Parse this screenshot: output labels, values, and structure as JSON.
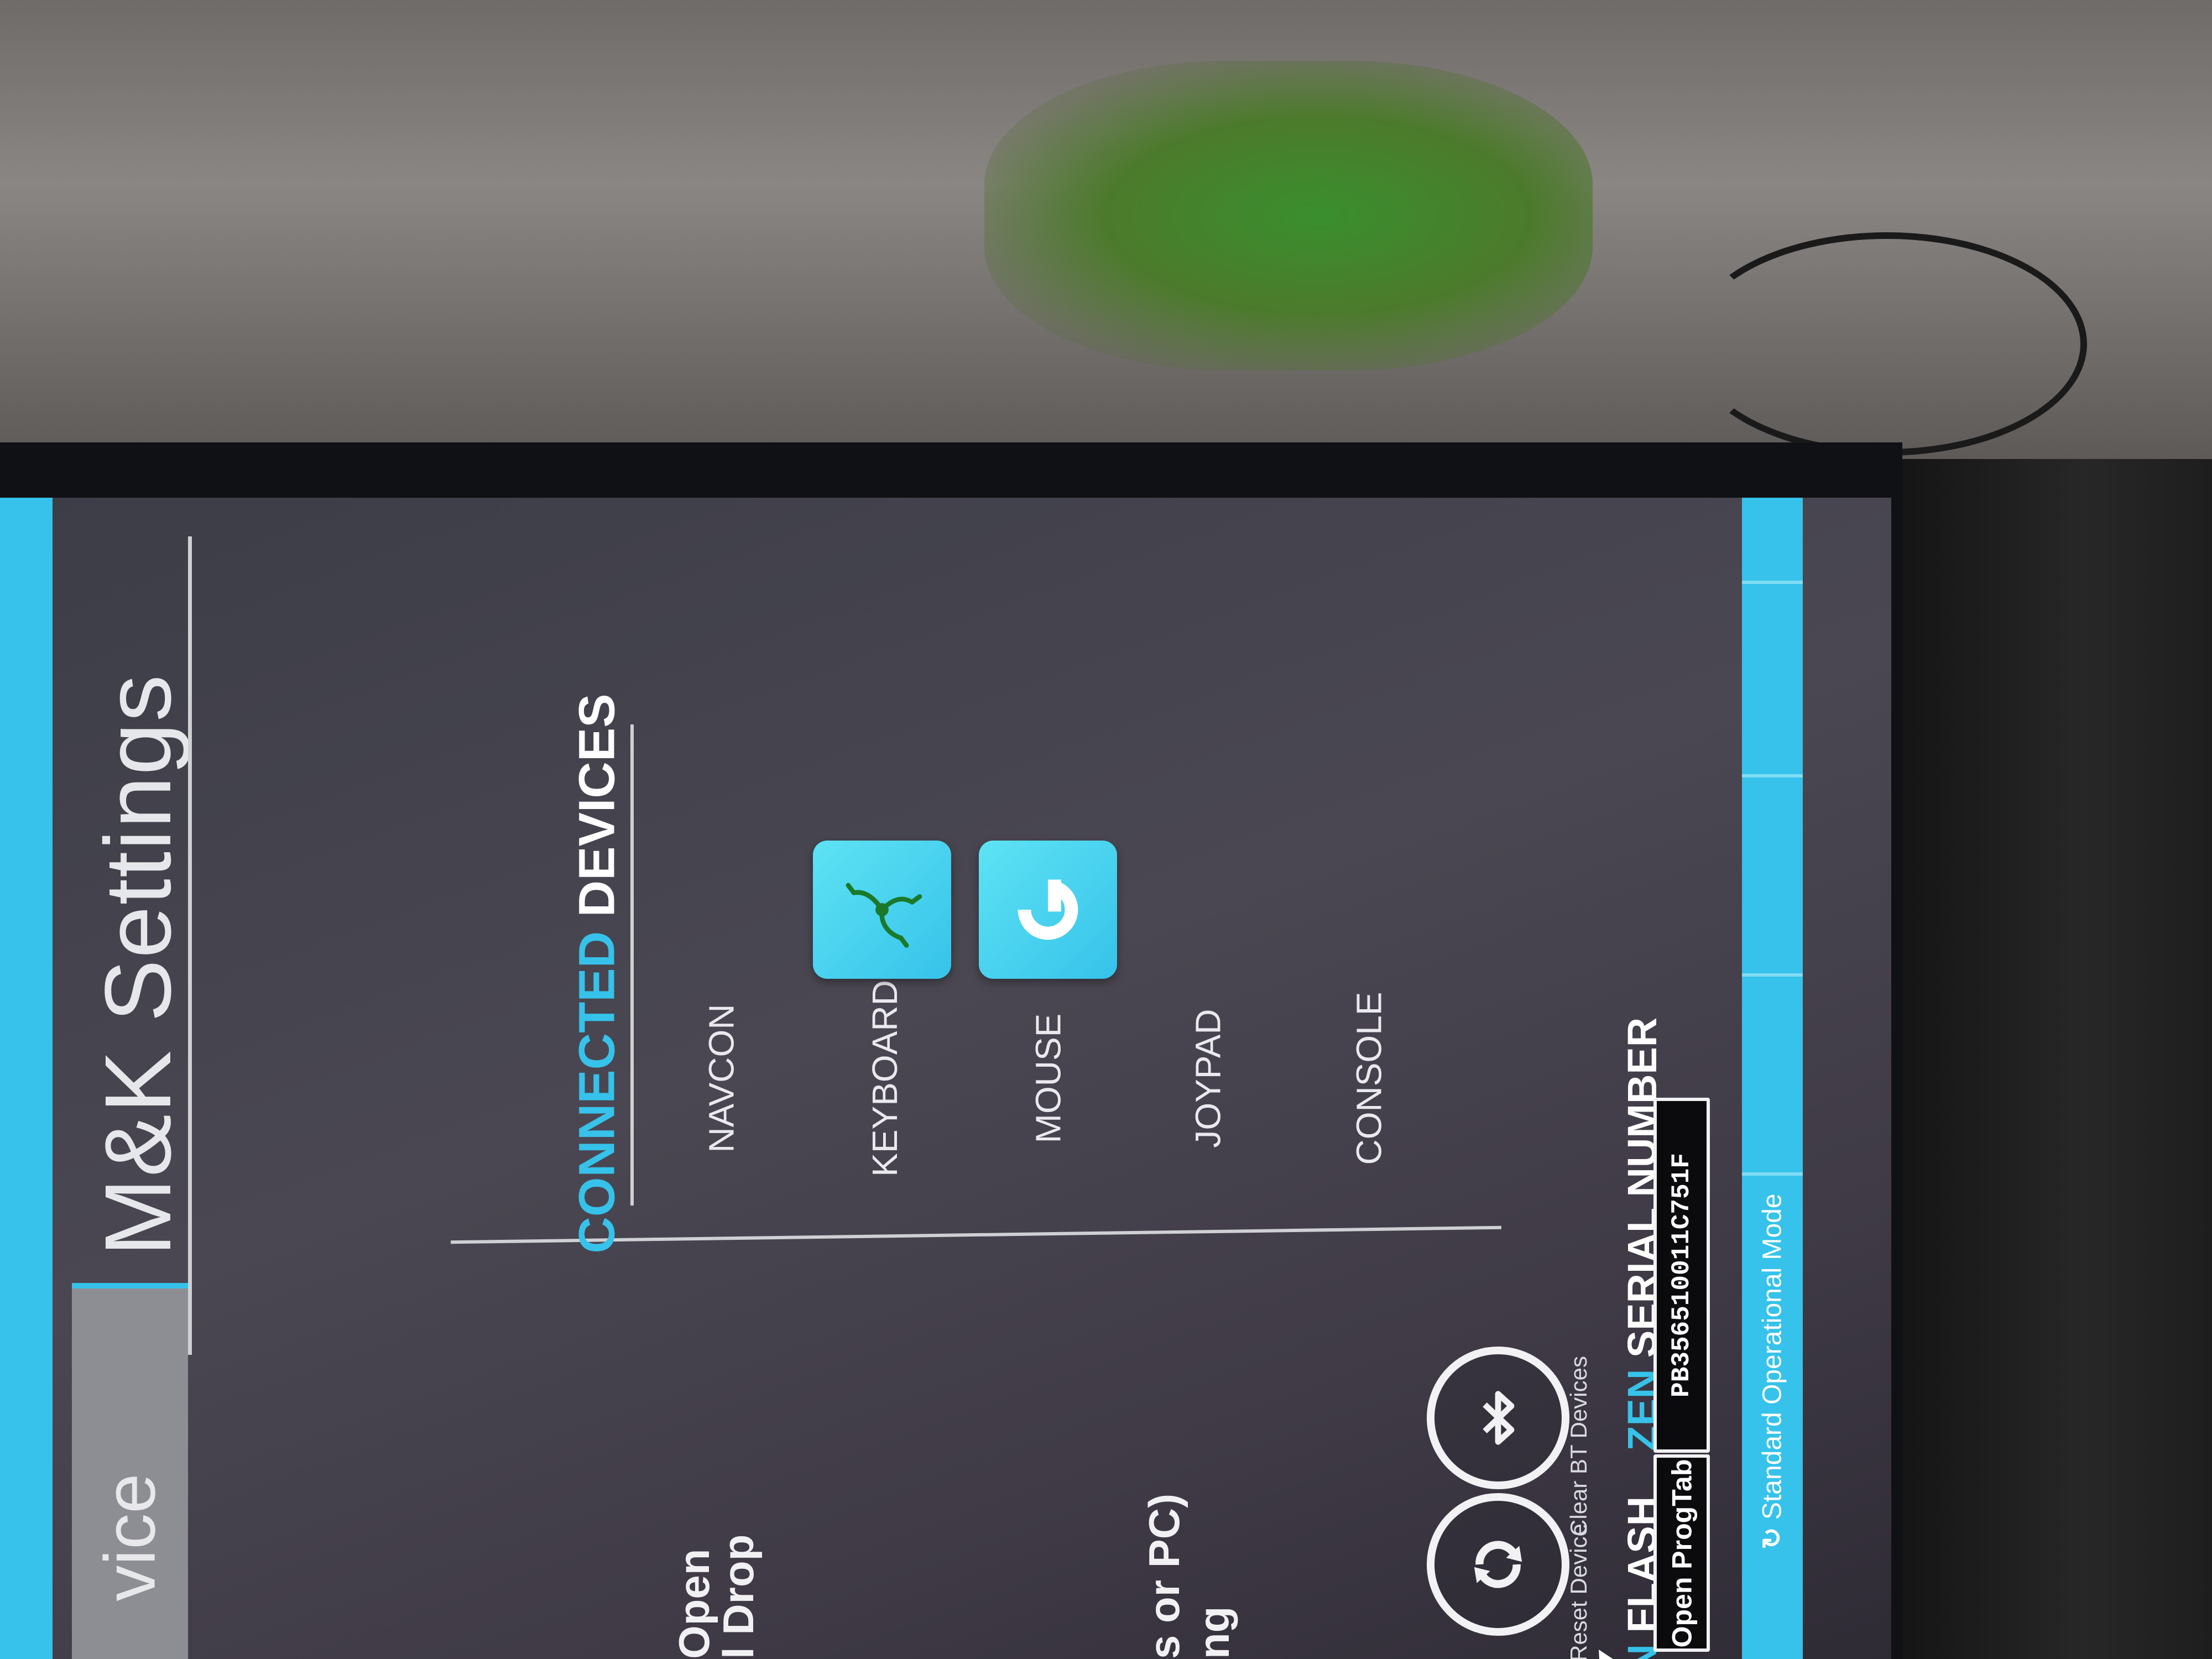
{
  "window": {
    "title": "M&K Settings",
    "side_tab_partial": "vice"
  },
  "left_panel": {
    "snippets": [
      "Open",
      "l Drop",
      "s or PC)",
      "ng"
    ]
  },
  "connected_devices": {
    "heading_part1": "CONNECTED",
    "heading_part2": "DEVICES",
    "items": [
      {
        "label": "NAVCON",
        "icon": null
      },
      {
        "label": "KEYBOARD",
        "icon": "razer-logo-icon"
      },
      {
        "label": "MOUSE",
        "icon": "logitech-logo-icon"
      },
      {
        "label": "JOYPAD",
        "icon": null
      },
      {
        "label": "CONSOLE",
        "icon": null
      }
    ]
  },
  "actions": {
    "reset_label": "Reset Device",
    "clear_bt_label": "Clear BT Devices"
  },
  "zen": {
    "flash_zen": "ZEN",
    "flash_word": "FLASH",
    "open_progtab_label": "Open ProgTab",
    "serial_zen": "ZEN",
    "serial_word": "SERIAL NUMBER",
    "serial_value": "PB356510011C751F"
  },
  "status": {
    "mode_text": "Standard Operational Mode"
  },
  "colors": {
    "accent": "#36c2ea",
    "background": "#3f3e48",
    "text": "#e9e9ee"
  }
}
